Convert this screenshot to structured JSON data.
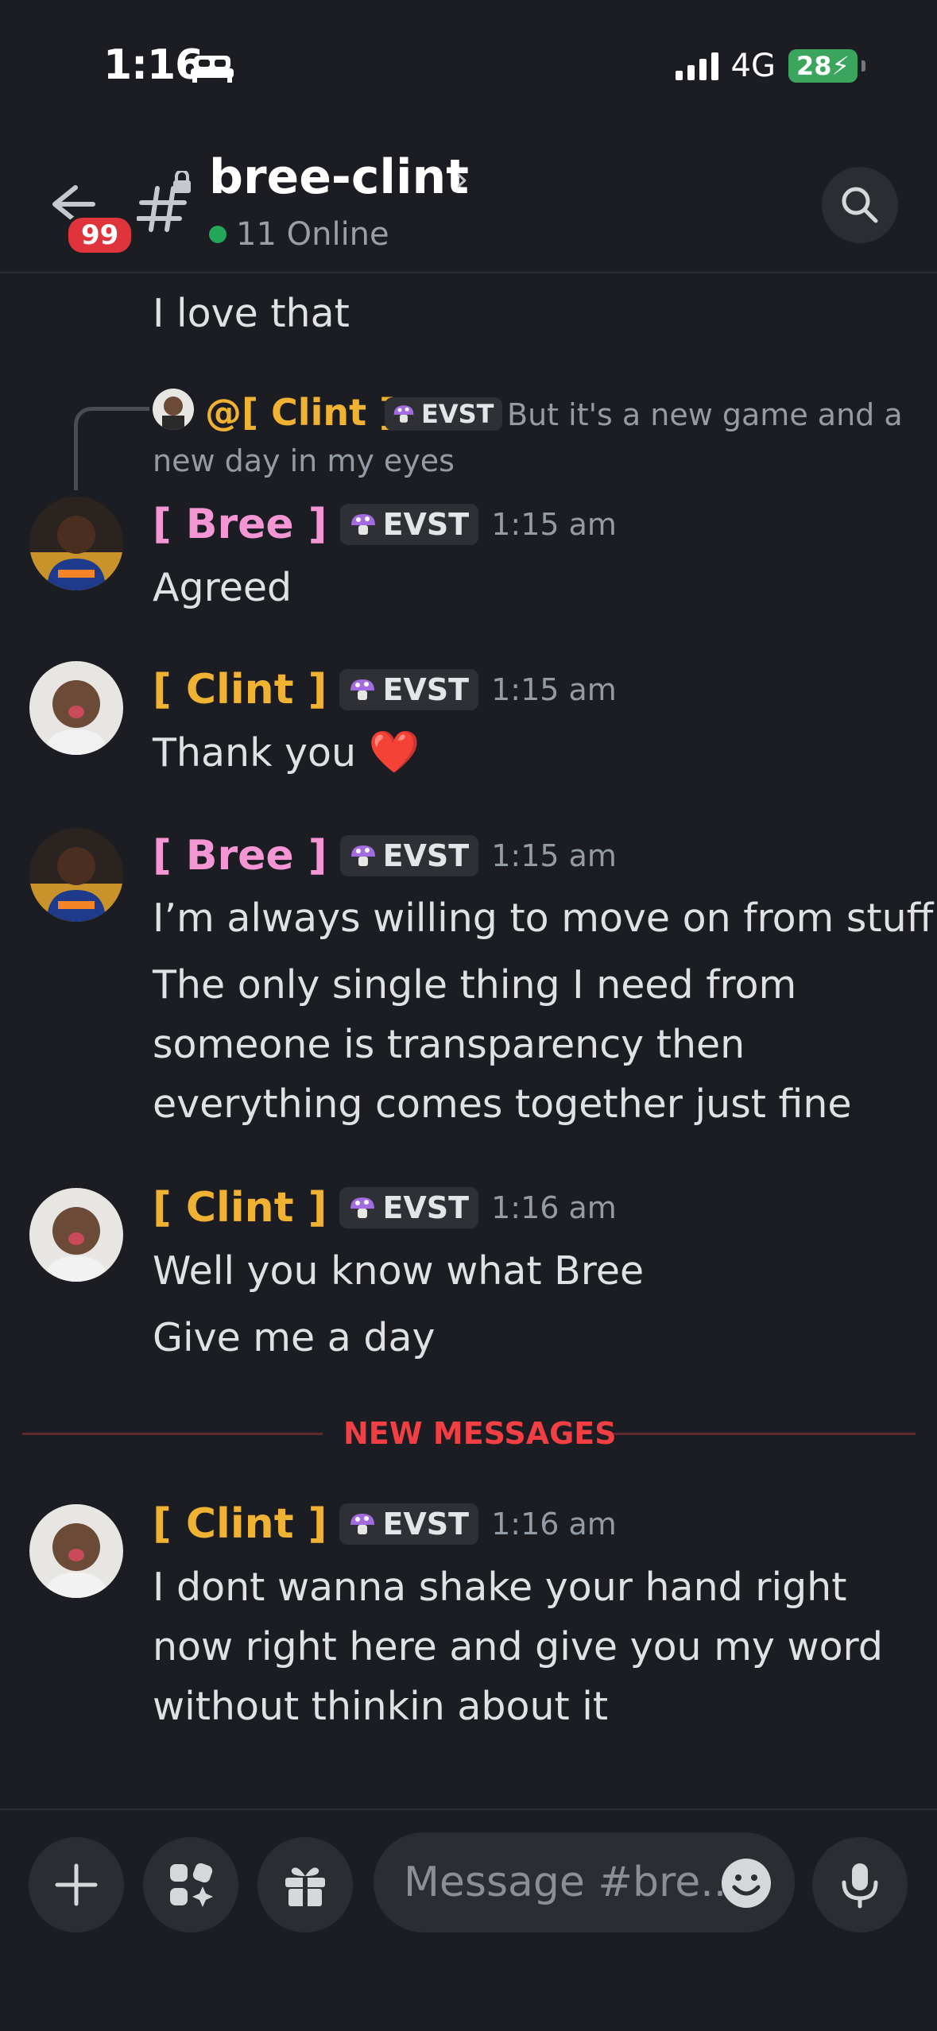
{
  "status_bar": {
    "time": "1:16",
    "network": "4G",
    "battery": "28"
  },
  "header": {
    "channel_name": "bree-clint",
    "online": "11 Online",
    "unread_badge": "99"
  },
  "messages": {
    "prev_text": "I love that",
    "reply": {
      "name": "@[ Clint ]",
      "tag": "EVST",
      "text1": "But it's a new game and a",
      "text2": "new day in my eyes"
    },
    "m1": {
      "name": "[ Bree ]",
      "tag": "EVST",
      "time": "1:15 am",
      "lines": [
        "Agreed"
      ]
    },
    "m2": {
      "name": "[ Clint ]",
      "tag": "EVST",
      "time": "1:15 am",
      "text": "Thank you",
      "emoji": "❤️"
    },
    "m3": {
      "name": "[ Bree ]",
      "tag": "EVST",
      "time": "1:15 am",
      "lines": [
        "I’m always willing to move on from stuff",
        "The only single thing I need from",
        "someone is transparency then",
        "everything comes together just fine"
      ]
    },
    "m4": {
      "name": "[ Clint ]",
      "tag": "EVST",
      "time": "1:16 am",
      "lines": [
        "Well you know what Bree",
        "Give me a day"
      ]
    },
    "divider": "NEW MESSAGES",
    "m5": {
      "name": "[ Clint ]",
      "tag": "EVST",
      "time": "1:16 am",
      "lines": [
        "I dont wanna shake your hand right",
        "now right here and give you my word",
        "without thinkin about it"
      ]
    }
  },
  "composer": {
    "placeholder": "Message #bre..."
  },
  "colors": {
    "bree": "#f396d3",
    "clint": "#f0b232",
    "new_messages": "#f23f43",
    "online": "#23a55a"
  }
}
